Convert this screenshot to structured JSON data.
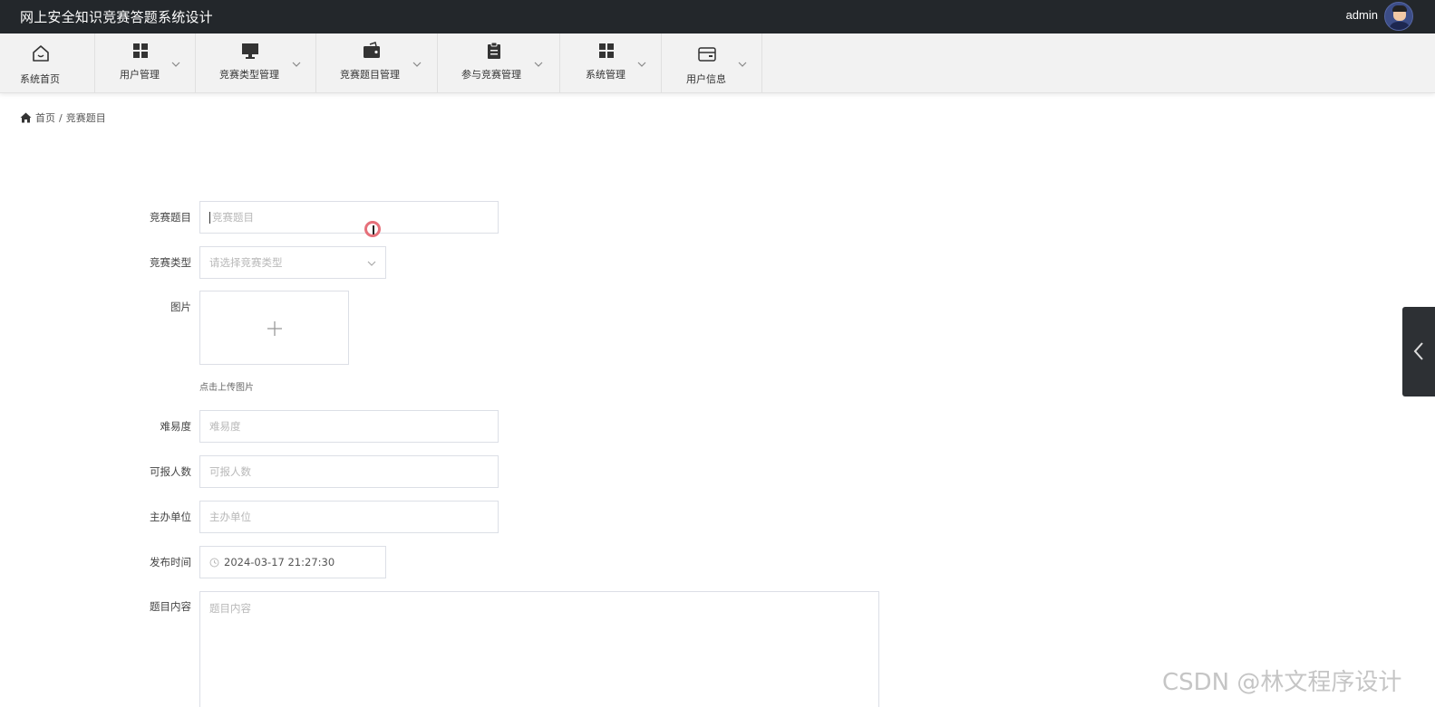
{
  "app": {
    "title": "网上安全知识竞赛答题系统设计",
    "username": "admin"
  },
  "nav": {
    "items": [
      {
        "label": "系统首页",
        "icon": "home-icon",
        "dropdown": false
      },
      {
        "label": "用户管理",
        "icon": "grid-icon",
        "dropdown": true
      },
      {
        "label": "竞赛类型管理",
        "icon": "monitor-icon",
        "dropdown": true
      },
      {
        "label": "竞赛题目管理",
        "icon": "wallet-icon",
        "dropdown": true
      },
      {
        "label": "参与竞赛管理",
        "icon": "clipboard-icon",
        "dropdown": true
      },
      {
        "label": "系统管理",
        "icon": "grid-icon",
        "dropdown": true
      },
      {
        "label": "用户信息",
        "icon": "card-icon",
        "dropdown": true
      }
    ]
  },
  "breadcrumb": {
    "home": "首页",
    "separator": "/",
    "current": "竞赛题目"
  },
  "form": {
    "title_label": "竞赛题目",
    "title_placeholder": "竞赛题目",
    "type_label": "竞赛类型",
    "type_placeholder": "请选择竞赛类型",
    "image_label": "图片",
    "upload_hint": "点击上传图片",
    "difficulty_label": "难易度",
    "difficulty_placeholder": "难易度",
    "capacity_label": "可报人数",
    "capacity_placeholder": "可报人数",
    "organizer_label": "主办单位",
    "organizer_placeholder": "主办单位",
    "publish_label": "发布时间",
    "publish_value": "2024-03-17 21:27:30",
    "content_label": "题目内容",
    "content_placeholder": "题目内容"
  },
  "watermark": "CSDN @林文程序设计",
  "colors": {
    "topbar": "#23272b",
    "nav_bg": "#f2f2f2",
    "border": "#dcdfe6",
    "placeholder": "#b8b8b8"
  }
}
